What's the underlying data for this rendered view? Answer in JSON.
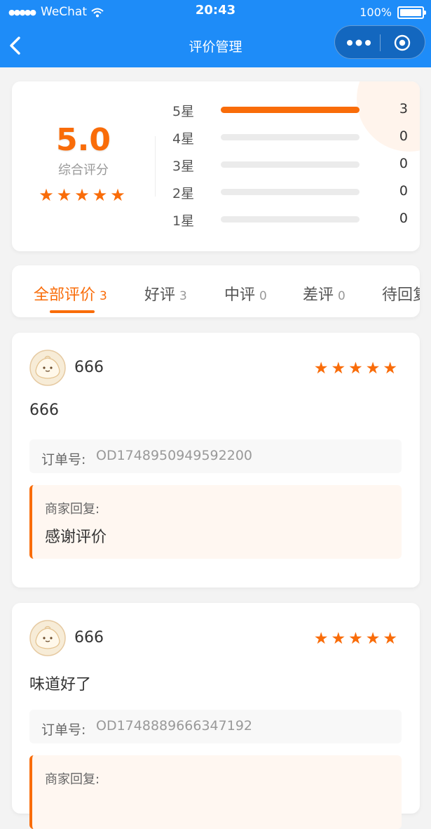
{
  "status_bar": {
    "carrier": "WeChat",
    "time": "20:43",
    "battery": "100%"
  },
  "header": {
    "title": "评价管理",
    "more_icon": "more-dots-icon",
    "close_icon": "target-circle-icon",
    "back_icon": "chevron-left-icon"
  },
  "summary": {
    "score": "5.0",
    "score_label": "综合评分",
    "stars": "★★★★★",
    "distribution": [
      {
        "label": "5星",
        "count": "3",
        "fraction": 1.0
      },
      {
        "label": "4星",
        "count": "0",
        "fraction": 0
      },
      {
        "label": "3星",
        "count": "0",
        "fraction": 0
      },
      {
        "label": "2星",
        "count": "0",
        "fraction": 0
      },
      {
        "label": "1星",
        "count": "0",
        "fraction": 0
      }
    ]
  },
  "tabs": [
    {
      "label": "全部评价",
      "count": "3",
      "active": true
    },
    {
      "label": "好评",
      "count": "3"
    },
    {
      "label": "中评",
      "count": "0"
    },
    {
      "label": "差评",
      "count": "0"
    },
    {
      "label": "待回复",
      "count": ""
    }
  ],
  "reviews": [
    {
      "username": "666",
      "stars": "★★★★★",
      "content": "666",
      "order_label": "订单号:",
      "order_no": "OD1748950949592200",
      "reply_label": "商家回复:",
      "reply": "感谢评价"
    },
    {
      "username": "666",
      "stars": "★★★★★",
      "content": "味道好了",
      "order_label": "订单号:",
      "order_no": "OD1748889666347192",
      "reply_label": "商家回复:",
      "reply": ""
    }
  ],
  "colors": {
    "brand_blue": "#1e8cf8",
    "accent_orange": "#f96c09"
  }
}
